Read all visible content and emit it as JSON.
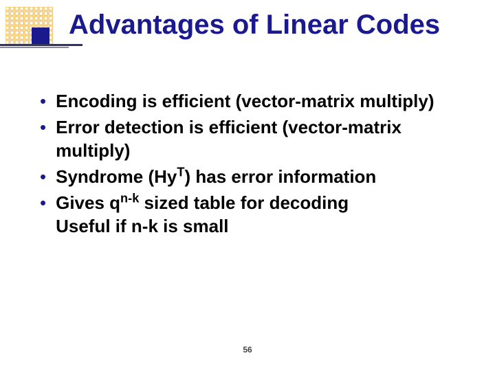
{
  "title": "Advantages of Linear Codes",
  "bullets": [
    {
      "html": "Encoding is efficient (vector-matrix multiply)"
    },
    {
      "html": "Error detection is efficient (vector-matrix multiply)"
    },
    {
      "html": "Syndrome (Hy<sup>T</sup>) has error information"
    },
    {
      "html": "Gives q<sup>n-k</sup> sized table for decoding<br>Useful if n-k is small"
    }
  ],
  "page_number": "56",
  "logo": {
    "grid_color": "#f0b030",
    "square_color": "#1a1a8e"
  }
}
